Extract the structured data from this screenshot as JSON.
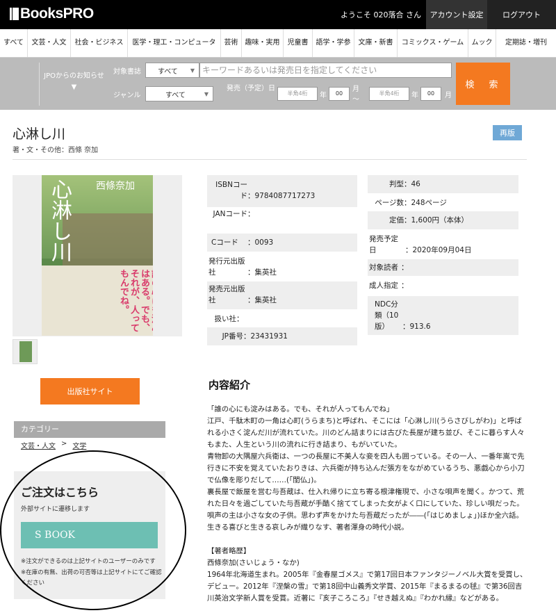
{
  "header": {
    "logo": "BooksPRO",
    "welcome": "ようこそ 020落合 さん",
    "account_label": "アカウント設定",
    "logout_label": "ログアウト"
  },
  "categories": [
    "すべて",
    "文芸・人文",
    "社会・ビジネス",
    "医学・理工・コンピュータ",
    "芸術",
    "趣味・実用",
    "児童書",
    "語学・学参",
    "文庫・新書",
    "コミックス・ゲーム",
    "ムック",
    "定期誌・増刊"
  ],
  "search": {
    "jpo_label": "JPOからのお知らせ",
    "target_label": "対象書誌",
    "target_value": "すべて",
    "keyword_placeholder": "キーワードあるいは発売日を指定してください",
    "genre_label": "ジャンル",
    "genre_value": "すべて",
    "release_label": "発売（予定）日",
    "year_placeholder": "半角4桁",
    "month_value": "00",
    "year_unit": "年",
    "month_unit": "月～",
    "month_unit_end": "月",
    "search_label": "検　索"
  },
  "book": {
    "title": "心淋し川",
    "byline": "著・文・その他：西條 奈加",
    "reprint_label": "再版",
    "cover_author": "西條奈加",
    "cover_title": "心淋し川",
    "cover_copy": "誰の心にも淀みはある。でも、それが、人ってもんでね。"
  },
  "details_left": [
    {
      "key": "ISBNコード",
      "value": "9784087717273"
    },
    {
      "key": "JANコード",
      "value": ""
    },
    {
      "key": "Cコード",
      "value": "0093"
    },
    {
      "key": "発行元出版社",
      "value": "集英社"
    },
    {
      "key": "発売元出版社",
      "value": "集英社"
    },
    {
      "key": "扱い社",
      "value": ""
    },
    {
      "key": "JP番号",
      "value": "23431931"
    }
  ],
  "details_right": [
    {
      "key": "判型",
      "value": "46"
    },
    {
      "key": "ページ数",
      "value": "248ページ"
    },
    {
      "key": "定価",
      "value": "1,600円（本体）"
    },
    {
      "key": "発売予定日",
      "value": "2020年09月04日"
    },
    {
      "key": "対象読者",
      "value": ""
    },
    {
      "key": "成人指定",
      "value": ""
    },
    {
      "key": "NDC分類（10版）",
      "value": "913.6"
    }
  ],
  "sidebar": {
    "publisher_site_label": "出版社サイト",
    "category_heading": "カテゴリー",
    "crumb_1": "文芸・人文",
    "crumb_sep": ">",
    "crumb_2": "文学",
    "order_title": "ご注文はこちら",
    "order_sub": "外部サイトに遷移します",
    "sbook_label": "S BOOK",
    "note_1": "※注文ができるのは上記サイトのユーザーのみです",
    "note_2": "※在庫の有無、出荷の可否等は上記サイトにてご確認ください"
  },
  "description": {
    "heading": "内容紹介",
    "p1": "「誰の心にも淀みはある。でも、それが人ってもんでね」",
    "p2": "江戸、千駄木町の一角は心町(うらまち)と呼ばれ、そこには「心淋し川(うらさびしがわ)」と呼ばれる小さく淀んだ川が流れていた。川のどん詰まりには古びた長屋が建ち並び、そこに暮らす人々もまた、人生という川の流れに行き詰まり、もがいていた。",
    "p3": "青物卸の大隅屋六兵衛は、一つの長屋に不美人な妾を四人も囲っている。その一人、一番年嵩で先行きに不安を覚えていたおりきは、六兵衛が持ち込んだ張方をながめているうち、悪戯心から小刀で仏像を彫りだして……(「閨仏」)。",
    "p4": "裏長屋で飯屋を営む与吾蔵は、仕入れ帰りに立ち寄る根津権現で、小さな唄声を聞く。かつて、荒れた日々を過ごしていた与吾蔵が手酷く捨ててしまった女がよく口にしていた、珍しい唄だった。唄声の主は小さな女の子供。思わず声をかけた与吾蔵だったが――(「はじめましょ」)ほか全六話。",
    "p5": "生きる喜びと生きる哀しみが織りなす、著者渾身の時代小説。",
    "p6": "【著者略歴】",
    "p7": "西條奈加(さいじょう・なか)",
    "p8": "1964年北海道生まれ。2005年『金春屋ゴメス』で第17回日本ファンタジーノベル大賞を受賞し、デビュー。2012年『涅槃の雪』で第18回中山義秀文学賞、2015年『まるまるの毬』で第36回吉川英治文学新人賞を受賞。近著に『亥子ころころ』『せき越えぬ』『わかれ縁』などがある。"
  }
}
